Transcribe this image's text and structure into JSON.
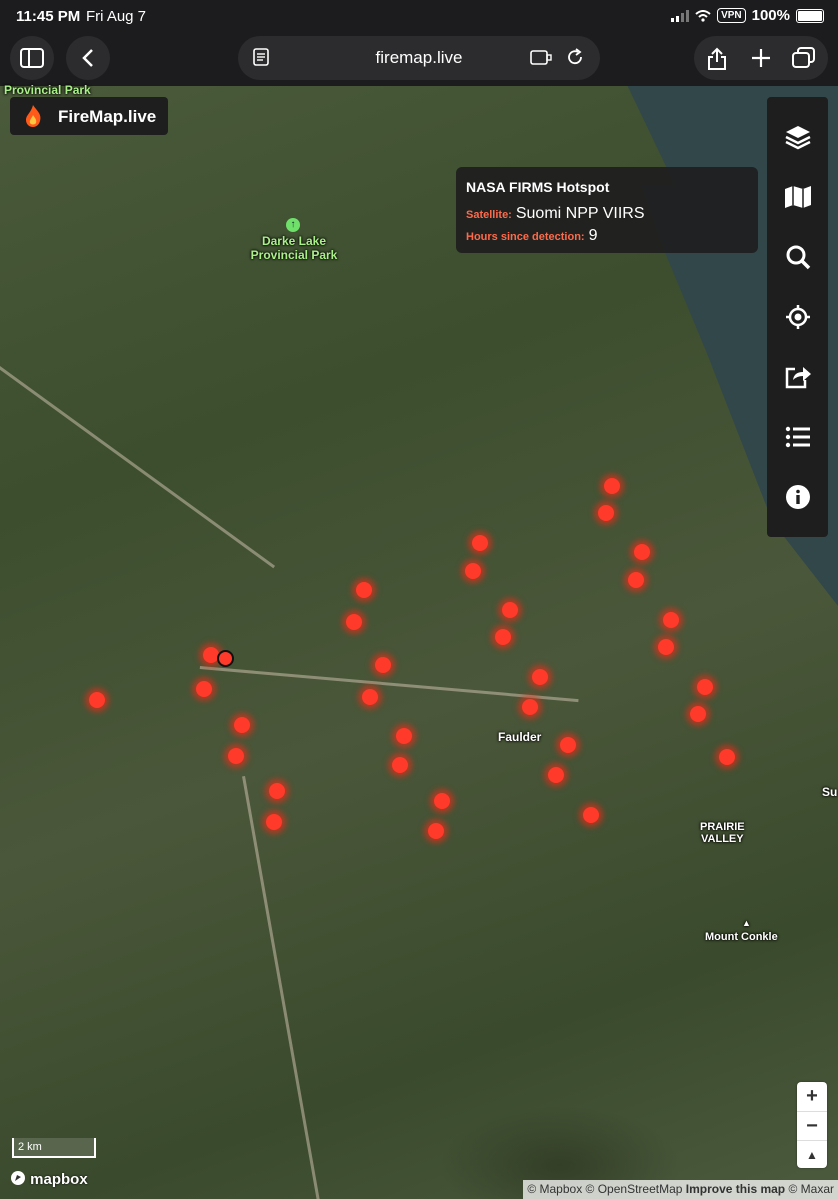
{
  "status": {
    "time": "11:45 PM",
    "date": "Fri Aug 7",
    "vpn": "VPN",
    "battery": "100%"
  },
  "browser": {
    "url": "firemap.live"
  },
  "app": {
    "name": "FireMap.live"
  },
  "popup": {
    "title": "NASA FIRMS Hotspot",
    "satellite_label": "Satellite:",
    "satellite_value": "Suomi NPP VIIRS",
    "hours_label": "Hours since detection:",
    "hours_value": "9"
  },
  "places": {
    "top_park": "Provincial Park",
    "darke_line1": "Darke Lake",
    "darke_line2": "Provincial Park",
    "faulder": "Faulder",
    "prairie1": "PRAIRIE",
    "prairie2": "VALLEY",
    "conkle": "Mount Conkle",
    "su": "Su"
  },
  "scale": {
    "label": "2 km"
  },
  "brand": {
    "mapbox": "mapbox"
  },
  "attribution": {
    "mapbox": "© Mapbox",
    "osm": "© OpenStreetMap",
    "improve": "Improve this map",
    "maxar": "© Maxar"
  },
  "zoom": {
    "in": "+",
    "out": "−",
    "north": "▲"
  },
  "colors": {
    "hotspot": "#ff3a2a",
    "popup_label": "#ff6a4a",
    "panel": "#1e1e1e"
  },
  "sidebar_icons": [
    "layers-icon",
    "map-icon",
    "search-icon",
    "locate-icon",
    "share-icon",
    "list-icon",
    "info-icon"
  ],
  "hotspot_count": 37
}
